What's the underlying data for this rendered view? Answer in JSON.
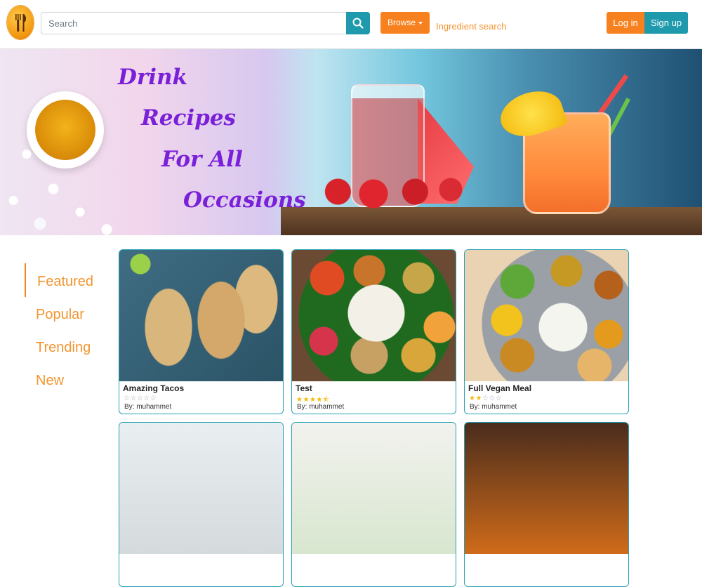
{
  "header": {
    "search_placeholder": "Search",
    "browse_label": "Browse",
    "ingredient_search_label": "Ingredient search",
    "login_label": "Log in",
    "signup_label": "Sign up"
  },
  "hero": {
    "lines": [
      "Drink",
      "Recipes",
      "For All",
      "Occasions"
    ]
  },
  "sidebar": {
    "items": [
      {
        "label": "Featured",
        "active": true
      },
      {
        "label": "Popular",
        "active": false
      },
      {
        "label": "Trending",
        "active": false
      },
      {
        "label": "New",
        "active": false
      }
    ]
  },
  "recipes": [
    {
      "title": "Amazing Tacos",
      "rating": 0,
      "author": "By: muhammet"
    },
    {
      "title": "Test",
      "rating": 4.5,
      "author": "By: muhammet"
    },
    {
      "title": "Full Vegan Meal",
      "rating": 2,
      "author": "By: muhammet"
    }
  ],
  "colors": {
    "accent_orange": "#f6811e",
    "accent_teal": "#1e9aac",
    "headline_purple": "#7a20d8",
    "star": "#f2b90c"
  }
}
